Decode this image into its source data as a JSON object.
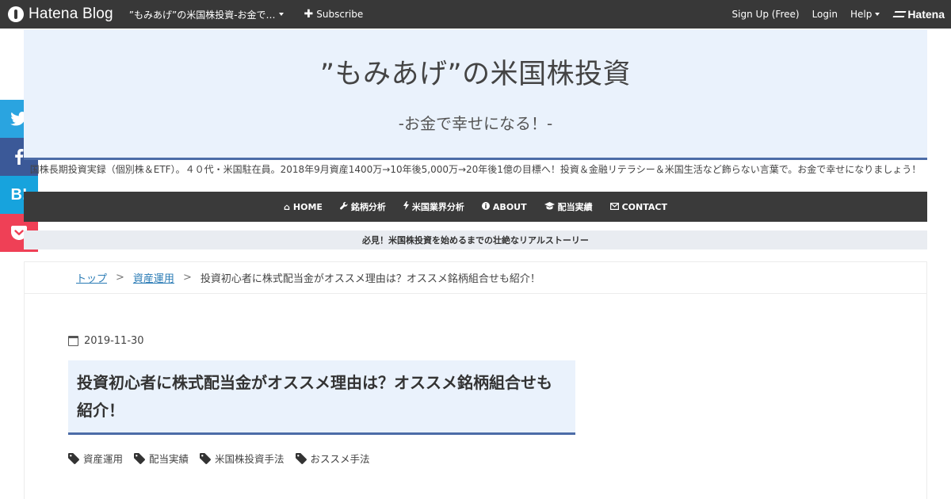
{
  "topbar": {
    "logo_text": "Hatena Blog",
    "blog_switch_label": "”もみあげ”の米国株投資-お金で…",
    "subscribe_label": "Subscribe",
    "signup_label": "Sign Up (Free)",
    "login_label": "Login",
    "help_label": "Help",
    "hatena_label": "Hatena"
  },
  "share": {
    "items": [
      {
        "name": "twitter-icon",
        "color": "#2aa4e0"
      },
      {
        "name": "facebook-icon",
        "color": "#3b5998"
      },
      {
        "name": "hatena-bookmark-icon",
        "label": "B!",
        "color": "#17a3dd"
      },
      {
        "name": "pocket-icon",
        "color": "#ef4056"
      }
    ]
  },
  "header": {
    "title": "”もみあげ”の米国株投資",
    "subtitle": "-お金で幸せになる！-",
    "background": "#eaf2fc",
    "accent": "#4c6ca7"
  },
  "description": "国株長期投資実録（個別株＆ETF）。４０代・米国駐在員。2018年9月資産1400万→10年後5,000万→20年後1億の目標へ！投資＆金融リテラシー＆米国生活など飾らない言葉で。お金で幸せになりましょう！",
  "nav": {
    "items": [
      {
        "icon": "home-icon",
        "glyph": "⌂",
        "label": "HOME"
      },
      {
        "icon": "wrench-icon",
        "glyph": "🔧",
        "label": "銘柄分析"
      },
      {
        "icon": "bolt-icon",
        "glyph": "⚡",
        "label": "米国業界分析"
      },
      {
        "icon": "info-icon",
        "glyph": "ℹ",
        "label": "ABOUT"
      },
      {
        "icon": "graduation-cap-icon",
        "glyph": "🎓",
        "label": "配当実績"
      },
      {
        "icon": "envelope-icon",
        "glyph": "✉",
        "label": "CONTACT"
      }
    ]
  },
  "notice": "必見！米国株投資を始めるまでの壮絶なリアルストーリー",
  "breadcrumb": {
    "top": "トップ",
    "category": "資産運用",
    "sep": ">",
    "current": "投資初心者に株式配当金がオススメ理由は？オススメ銘柄組合せも紹介！"
  },
  "entry": {
    "date": "2019-11-30",
    "title": "投資初心者に株式配当金がオススメ理由は？オススメ銘柄組合せも紹介！",
    "categories": [
      "資産運用",
      "配当実績",
      "米国株投資手法",
      "おススメ手法"
    ]
  }
}
